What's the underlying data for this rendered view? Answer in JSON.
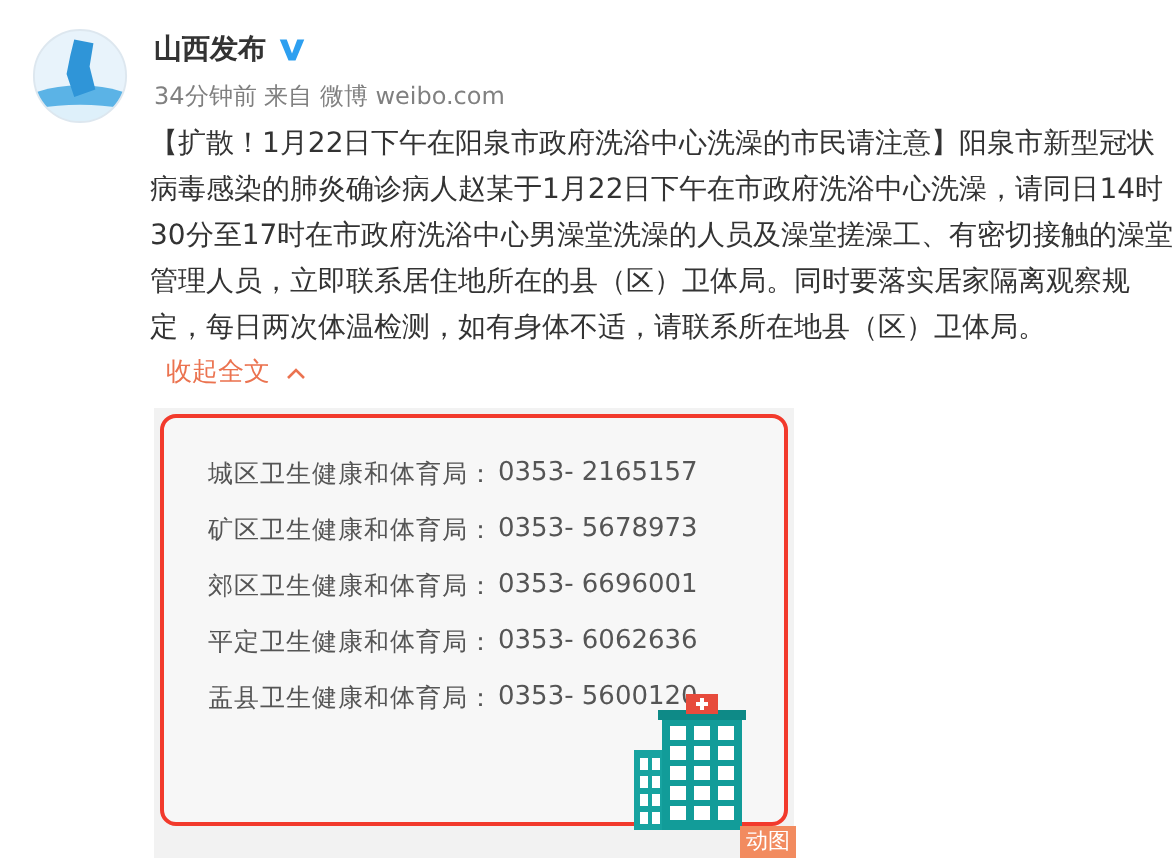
{
  "account": {
    "name": "山西发布",
    "verified": true,
    "meta": "34分钟前 来自 微博 weibo.com"
  },
  "post": {
    "text": "【扩散！1月22日下午在阳泉市政府洗浴中心洗澡的市民请注意】阳泉市新型冠状病毒感染的肺炎确诊病人赵某于1月22日下午在市政府洗浴中心洗澡，请同日14时30分至17时在市政府洗浴中心男澡堂洗澡的人员及澡堂搓澡工、有密切接触的澡堂管理人员，立即联系居住地所在的县（区）卫体局。同时要落实居家隔离观察规定，每日两次体温检测，如有身体不适，请联系所在地县（区）卫体局。",
    "collapse_link": "收起全文"
  },
  "image": {
    "lines": [
      {
        "label": "城区卫生健康和体育局：",
        "phone": "0353- 2165157"
      },
      {
        "label": "矿区卫生健康和体育局：",
        "phone": "0353- 5678973"
      },
      {
        "label": "郊区卫生健康和体育局：",
        "phone": "0353- 6696001"
      },
      {
        "label": "平定卫生健康和体育局：",
        "phone": "0353- 6062636"
      },
      {
        "label": "盂县卫生健康和体育局：",
        "phone": "0353- 5600120"
      }
    ],
    "badge": "动图"
  }
}
